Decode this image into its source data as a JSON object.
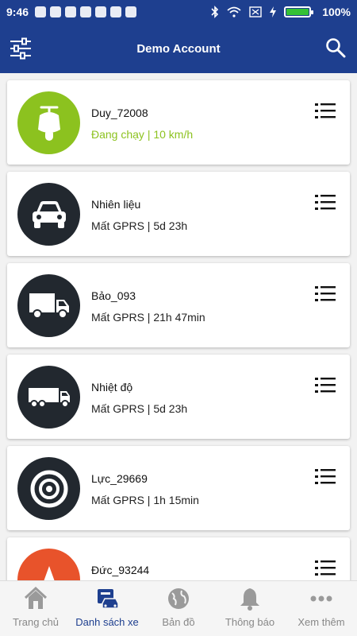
{
  "status_bar": {
    "time": "9:46",
    "battery_text": "100%",
    "battery_level": 1.0
  },
  "header": {
    "title": "Demo Account",
    "filter_icon": "sliders-icon",
    "search_icon": "search-icon"
  },
  "vehicles": [
    {
      "name": "Duy_72008",
      "status": "Đang chạy | 10 km/h",
      "state": "running",
      "icon": "scooter-icon",
      "color": "#8cc21f"
    },
    {
      "name": "Nhiên liệu",
      "status": "Mất GPRS | 5d 23h",
      "state": "lost",
      "icon": "car-icon",
      "color": "#22282f"
    },
    {
      "name": "Bảo_093",
      "status": "Mất GPRS | 21h 47min",
      "state": "lost",
      "icon": "truck-icon",
      "color": "#22282f"
    },
    {
      "name": "Nhiệt độ",
      "status": "Mất GPRS | 5d 23h",
      "state": "lost",
      "icon": "trailer-truck-icon",
      "color": "#22282f"
    },
    {
      "name": "Lực_29669",
      "status": "Mất GPRS | 1h 15min",
      "state": "lost",
      "icon": "target-icon",
      "color": "#22282f"
    },
    {
      "name": "Đức_93244",
      "status": "",
      "state": "other",
      "icon": "arrow-icon",
      "color": "#e8532b"
    }
  ],
  "bottom_nav": [
    {
      "label": "Trang chủ",
      "icon": "home-icon",
      "active": false
    },
    {
      "label": "Danh sách xe",
      "icon": "vehicle-list-icon",
      "active": true
    },
    {
      "label": "Bản đồ",
      "icon": "globe-icon",
      "active": false
    },
    {
      "label": "Thông báo",
      "icon": "bell-icon",
      "active": false
    },
    {
      "label": "Xem thêm",
      "icon": "more-icon",
      "active": false
    }
  ],
  "colors": {
    "brand": "#1e3f8f",
    "running": "#8cc21f",
    "inactive_nav": "#888888"
  }
}
